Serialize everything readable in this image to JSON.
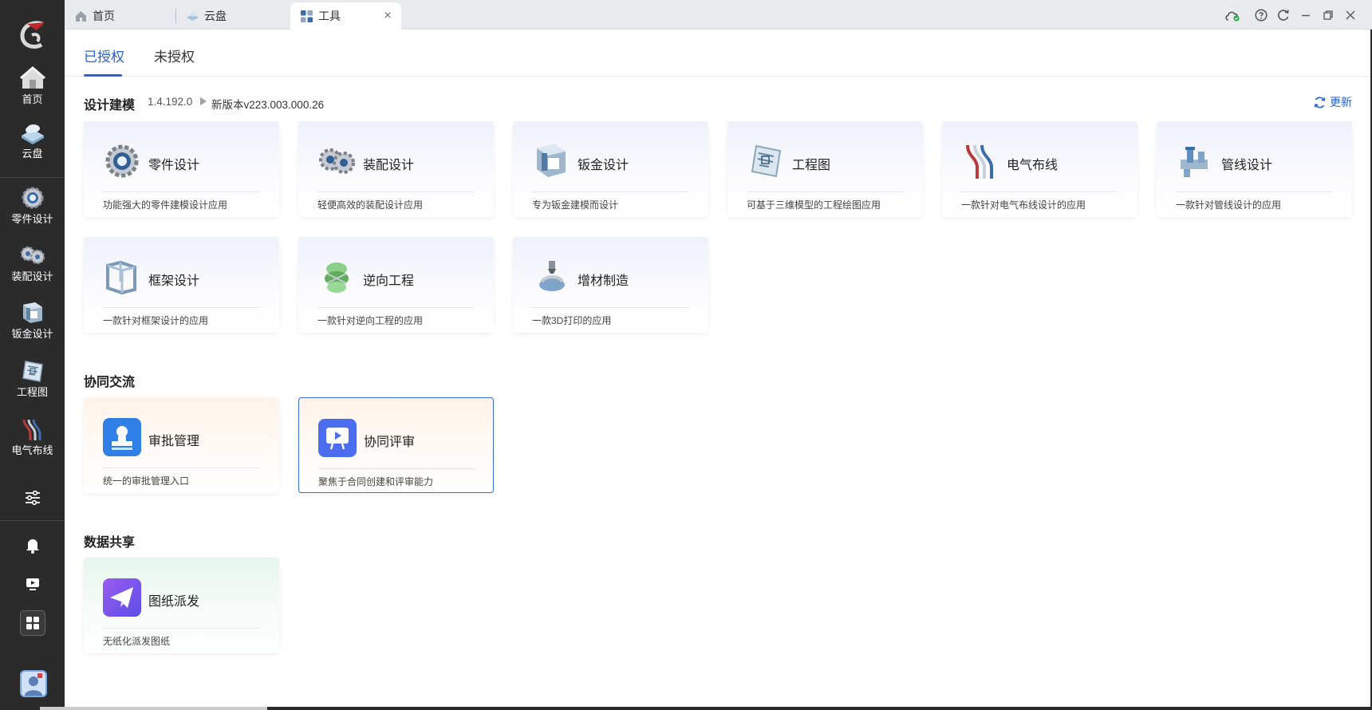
{
  "tabs": [
    {
      "label": "首页",
      "icon": "home-icon"
    },
    {
      "label": "云盘",
      "icon": "cloud-disk-icon"
    },
    {
      "label": "工具",
      "icon": "tools-grid-icon",
      "active": true
    }
  ],
  "window_controls": [
    "cloud-sync-icon",
    "help-icon",
    "refresh-icon",
    "minimize-icon",
    "restore-icon",
    "close-icon"
  ],
  "sidebar": {
    "items": [
      {
        "label": "首页",
        "icon": "home-icon"
      },
      {
        "label": "云盘",
        "icon": "cloud-disk-icon"
      },
      {
        "label": "零件设计",
        "icon": "part-gear-icon"
      },
      {
        "label": "装配设计",
        "icon": "assembly-gears-icon"
      },
      {
        "label": "钣金设计",
        "icon": "sheet-metal-icon"
      },
      {
        "label": "工程图",
        "icon": "drawing-icon"
      },
      {
        "label": "电气布线",
        "icon": "wiring-icon"
      }
    ],
    "bottom": [
      "settings-sliders-icon",
      "bell-icon",
      "video-icon",
      "apps-grid-icon",
      "avatar"
    ]
  },
  "subtabs": {
    "authorized": "已授权",
    "unauthorized": "未授权"
  },
  "design": {
    "title": "设计建模",
    "version": "1.4.192.0",
    "new_version": "新版本v223.003.000.26",
    "update_label": "更新",
    "cards": [
      {
        "name": "零件设计",
        "desc": "功能强大的零件建模设计应用",
        "icon": "part-gear-icon"
      },
      {
        "name": "装配设计",
        "desc": "轻便高效的装配设计应用",
        "icon": "assembly-gears-icon"
      },
      {
        "name": "钣金设计",
        "desc": "专为钣金建模而设计",
        "icon": "sheet-metal-icon"
      },
      {
        "name": "工程图",
        "desc": "可基于三维模型的工程绘图应用",
        "icon": "drawing-icon"
      },
      {
        "name": "电气布线",
        "desc": "一款针对电气布线设计的应用",
        "icon": "wiring-icon"
      },
      {
        "name": "管线设计",
        "desc": "一款针对管线设计的应用",
        "icon": "pipe-icon"
      },
      {
        "name": "框架设计",
        "desc": "一款针对框架设计的应用",
        "icon": "frame-icon"
      },
      {
        "name": "逆向工程",
        "desc": "一款针对逆向工程的应用",
        "icon": "reverse-eng-icon"
      },
      {
        "name": "增材制造",
        "desc": "一款3D打印的应用",
        "icon": "additive-icon"
      }
    ]
  },
  "collab": {
    "title": "协同交流",
    "cards": [
      {
        "name": "审批管理",
        "desc": "统一的审批管理入口",
        "icon": "approval-stamp-icon"
      },
      {
        "name": "协同评审",
        "desc": "聚焦于合同创建和评审能力",
        "icon": "review-screen-icon"
      }
    ]
  },
  "share": {
    "title": "数据共享",
    "cards": [
      {
        "name": "图纸派发",
        "desc": "无纸化派发图纸",
        "icon": "paper-plane-icon"
      }
    ]
  },
  "colors": {
    "accent": "#2a62d8",
    "sidebar": "#2b2b2b"
  }
}
